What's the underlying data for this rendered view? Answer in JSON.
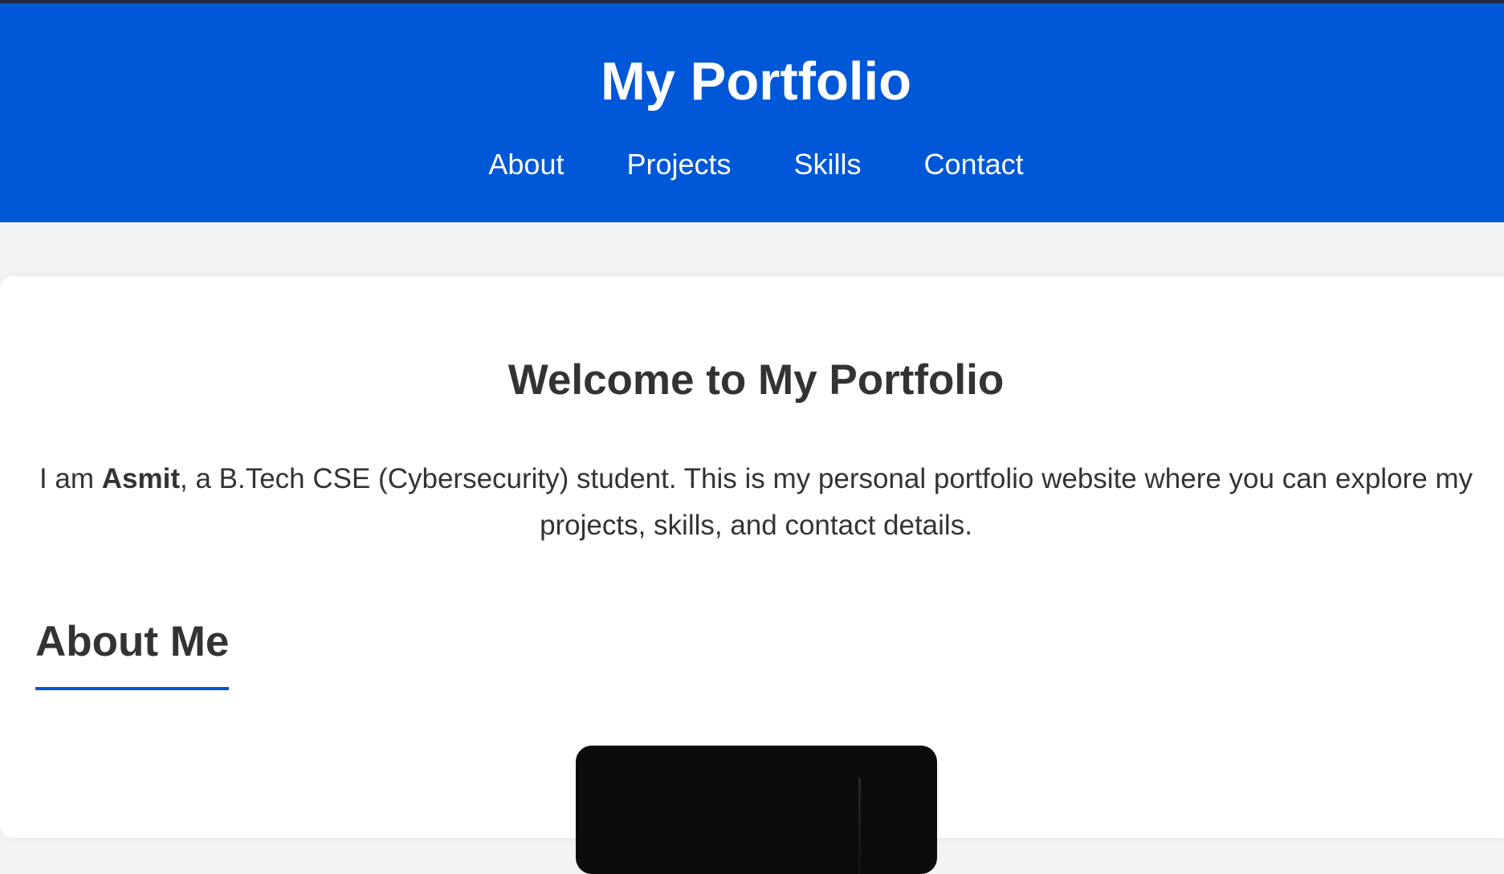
{
  "header": {
    "title": "My Portfolio",
    "nav": [
      {
        "label": "About"
      },
      {
        "label": "Projects"
      },
      {
        "label": "Skills"
      },
      {
        "label": "Contact"
      }
    ]
  },
  "welcome": {
    "heading": "Welcome to My Portfolio",
    "intro_prefix": "I am ",
    "name": "Asmit",
    "intro_suffix": ", a B.Tech CSE (Cybersecurity) student. This is my personal portfolio website where you can explore my projects, skills, and contact details."
  },
  "about": {
    "heading": "About Me"
  },
  "colors": {
    "header_bg": "#0057d7",
    "page_bg": "#f2f3f5",
    "text": "#333333",
    "accent": "#0057d7"
  }
}
